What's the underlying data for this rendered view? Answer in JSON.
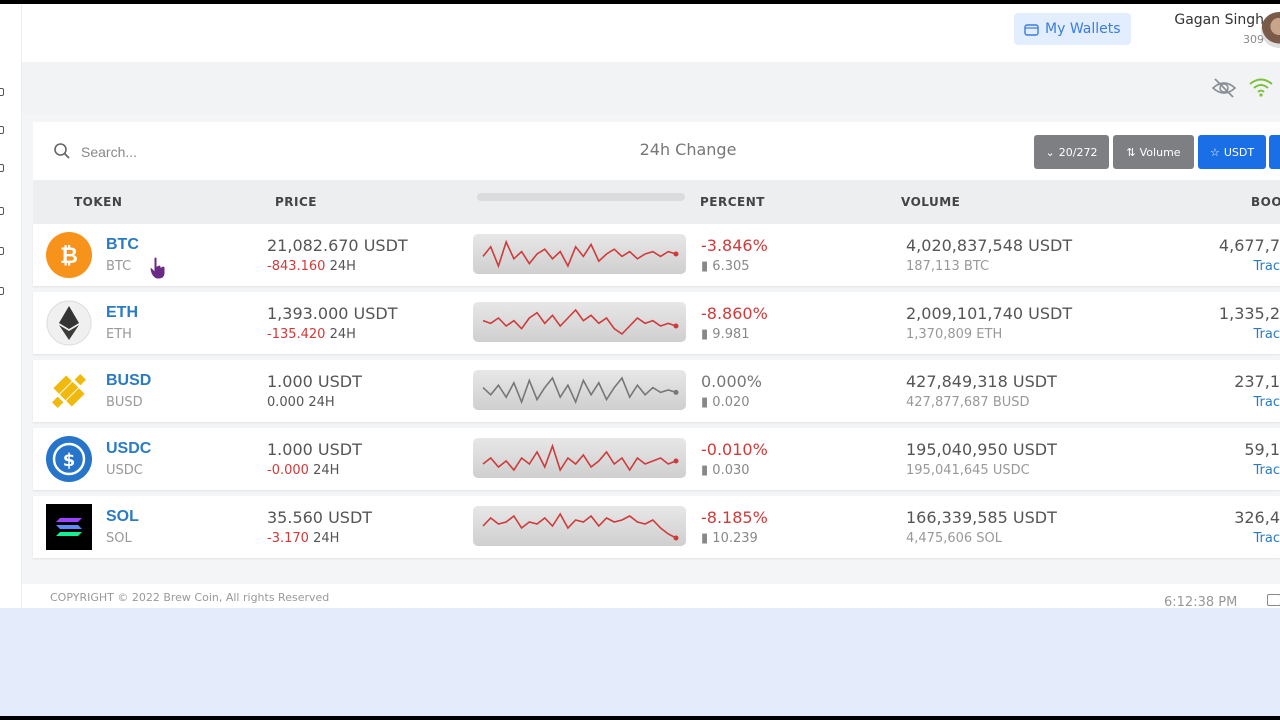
{
  "header": {
    "wallet_button": "My Wallets",
    "user_name": "Gagan Singh",
    "user_id": "309"
  },
  "toolbar": {
    "search_placeholder": "Search...",
    "change_label": "24h Change",
    "count_button": "20/272",
    "volume_button": "Volume",
    "usdt_button": "USDT"
  },
  "columns": {
    "token": "TOKEN",
    "price": "PRICE",
    "percent": "PERCENT",
    "volume": "VOLUME",
    "book": "BOO"
  },
  "rows": [
    {
      "symbol": "BTC",
      "symbol_sub": "BTC",
      "price": "21,082.670 USDT",
      "price_change": "-843.160",
      "price_period": "24H",
      "percent": "-3.846%",
      "percent_sub": "6.305",
      "volume": "4,020,837,548 USDT",
      "volume_sub": "187,113 BTC",
      "book": "4,677,7",
      "trade": "Trac",
      "color": "#d03a3a",
      "trend": "down",
      "spark": [
        10,
        14,
        6,
        16,
        9,
        12,
        7,
        11,
        13,
        9,
        12,
        6,
        14,
        10,
        15,
        8,
        11,
        13,
        10,
        12,
        9,
        11,
        12,
        10,
        12,
        11
      ]
    },
    {
      "symbol": "ETH",
      "symbol_sub": "ETH",
      "price": "1,393.000 USDT",
      "price_change": "-135.420",
      "price_period": "24H",
      "percent": "-8.860%",
      "percent_sub": "9.981",
      "volume": "2,009,101,740 USDT",
      "volume_sub": "1,370,809 ETH",
      "book": "1,335,2",
      "trade": "Trac",
      "color": "#d03a3a",
      "trend": "down",
      "spark": [
        11,
        10,
        12,
        9,
        11,
        8,
        12,
        14,
        10,
        13,
        9,
        12,
        15,
        11,
        13,
        10,
        12,
        8,
        6,
        9,
        12,
        10,
        11,
        9,
        10,
        9
      ]
    },
    {
      "symbol": "BUSD",
      "symbol_sub": "BUSD",
      "price": "1.000 USDT",
      "price_change": "0.000",
      "price_period": "24H",
      "percent": "0.000%",
      "percent_sub": "0.020",
      "volume": "427,849,318 USDT",
      "volume_sub": "427,877,687 BUSD",
      "book": "237,1",
      "trade": "Trac",
      "color": "#777777",
      "trend": "flat",
      "spark": [
        12,
        9,
        13,
        8,
        14,
        6,
        15,
        7,
        12,
        16,
        8,
        13,
        6,
        15,
        9,
        14,
        7,
        12,
        16,
        8,
        13,
        9,
        12,
        10,
        11,
        10
      ]
    },
    {
      "symbol": "USDC",
      "symbol_sub": "USDC",
      "price": "1.000 USDT",
      "price_change": "-0.000",
      "price_period": "24H",
      "percent": "-0.010%",
      "percent_sub": "0.030",
      "volume": "195,040,950 USDT",
      "volume_sub": "195,041,645 USDC",
      "book": "59,1",
      "trade": "Trac",
      "color": "#d03a3a",
      "trend": "down",
      "spark": [
        10,
        12,
        9,
        11,
        8,
        12,
        10,
        14,
        9,
        16,
        8,
        12,
        10,
        13,
        9,
        11,
        14,
        10,
        12,
        8,
        12,
        10,
        11,
        12,
        10,
        11
      ]
    },
    {
      "symbol": "SOL",
      "symbol_sub": "SOL",
      "price": "35.560 USDT",
      "price_change": "-3.170",
      "price_period": "24H",
      "percent": "-8.185%",
      "percent_sub": "10.239",
      "volume": "166,339,585 USDT",
      "volume_sub": "4,475,606 SOL",
      "book": "326,4",
      "trade": "Trac",
      "color": "#d03a3a",
      "trend": "down",
      "spark": [
        10,
        14,
        11,
        12,
        15,
        9,
        12,
        11,
        14,
        10,
        16,
        9,
        13,
        12,
        15,
        10,
        14,
        12,
        13,
        15,
        12,
        11,
        13,
        9,
        6,
        4
      ]
    }
  ],
  "footer": {
    "copyright": "COPYRIGHT © 2022  Brew Coin, All rights Reserved",
    "clock": "6:12:38 PM"
  },
  "icons": {
    "hide": "eye-slash-icon",
    "signal": "wifi-icon",
    "wallet": "wallet-icon",
    "search": "search-icon"
  },
  "colors": {
    "accent": "#1a6fe6",
    "negative": "#d03a3a",
    "link": "#2a7ac4"
  }
}
